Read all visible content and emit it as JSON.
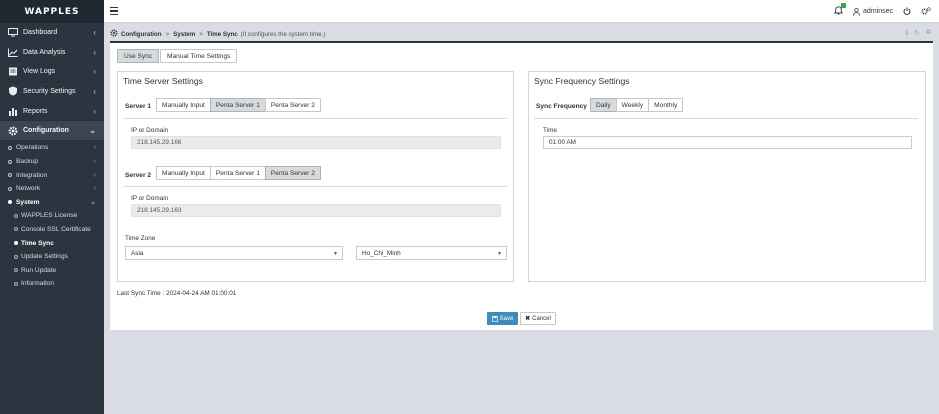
{
  "app": {
    "logo": "WAPPLES"
  },
  "sidebar": {
    "main": [
      {
        "label": "Dashboard"
      },
      {
        "label": "Data Analysis"
      },
      {
        "label": "View Logs"
      },
      {
        "label": "Security Settings"
      },
      {
        "label": "Reports"
      },
      {
        "label": "Configuration"
      }
    ],
    "config_items": [
      {
        "label": "Operations"
      },
      {
        "label": "Backup"
      },
      {
        "label": "Integration"
      },
      {
        "label": "Network"
      },
      {
        "label": "System"
      }
    ],
    "system_items": [
      {
        "label": "WAPPLES License"
      },
      {
        "label": "Console SSL Certificate"
      },
      {
        "label": "Time Sync"
      },
      {
        "label": "Update Settings"
      },
      {
        "label": "Run Update"
      },
      {
        "label": "Information"
      }
    ]
  },
  "topbar": {
    "username": "adminsec"
  },
  "breadcrumb": {
    "items": [
      "Configuration",
      "System",
      "Time Sync"
    ],
    "separator": ">",
    "description": "(It configures the system time.)"
  },
  "tabs": {
    "use_sync": "Use Sync",
    "manual": "Manual Time Settings"
  },
  "time_server": {
    "title": "Time Server Settings",
    "server1": {
      "label": "Server 1",
      "options": [
        "Manually Input",
        "Penta Server 1",
        "Penta Server 2"
      ],
      "ip_label": "IP or Domain",
      "ip_value": "218.145.29.166"
    },
    "server2": {
      "label": "Server 2",
      "options": [
        "Manually Input",
        "Penta Server 1",
        "Penta Server 2"
      ],
      "ip_label": "IP or Domain",
      "ip_value": "218.145.29.163"
    },
    "timezone": {
      "label": "Time Zone",
      "region": "Asia",
      "city": "Ho_Chi_Minh"
    }
  },
  "sync_freq": {
    "title": "Sync Frequency Settings",
    "label": "Sync Frequency",
    "options": [
      "Daily",
      "Weekly",
      "Monthly"
    ],
    "time_label": "Time",
    "time_value": "01:00 AM"
  },
  "status": {
    "last_sync": "Last Sync Time : 2024-04-24 AM 01:00:01"
  },
  "actions": {
    "save": "Save",
    "cancel": "Cancel"
  }
}
